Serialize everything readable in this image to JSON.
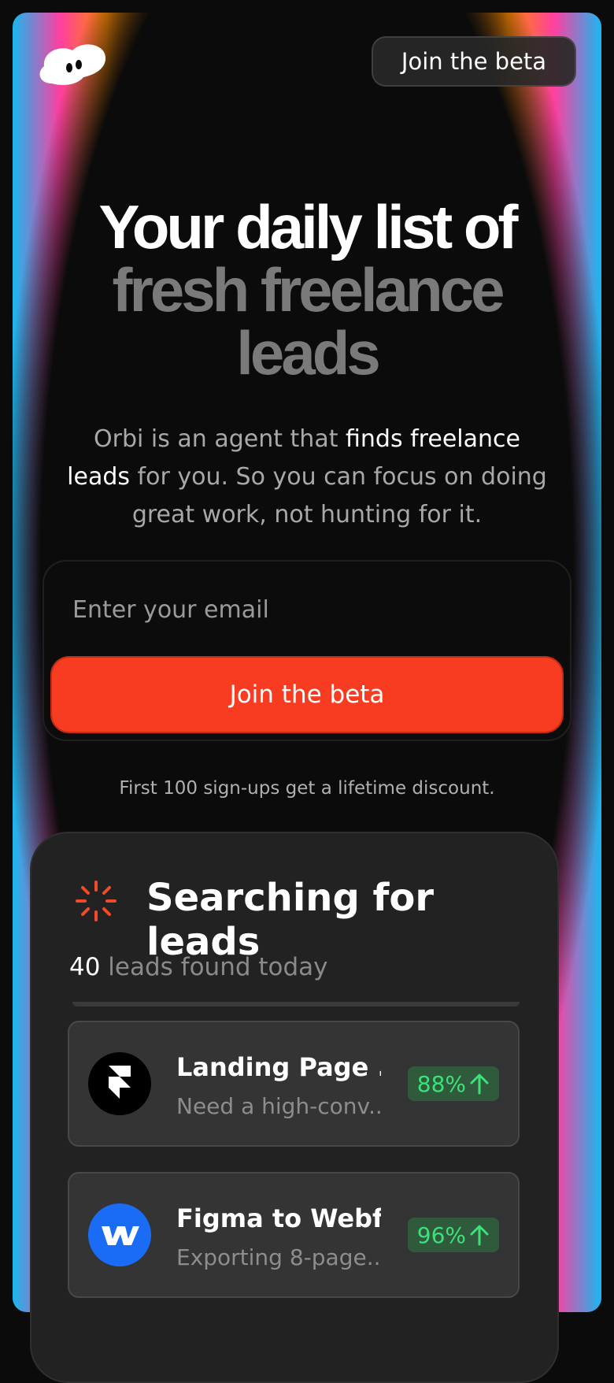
{
  "header": {
    "cta_label": "Join the beta"
  },
  "hero": {
    "line1": "Your daily list of",
    "line2": "fresh freelance",
    "line3": "leads"
  },
  "subtitle": {
    "part1": "Orbi is an agent that ",
    "highlight": "finds freelance leads",
    "part2": " for you. So you can focus on doing great work, not hunting for it."
  },
  "form": {
    "email_placeholder": "Enter your email",
    "submit_label": "Join the beta"
  },
  "note": "First 100 sign-ups get a lifetime discount.",
  "panel": {
    "title": "Searching for leads",
    "count": "40",
    "count_suffix": " leads found today",
    "leads": [
      {
        "title": "Landing Page ...",
        "desc": "Need a high-conv...",
        "score": "88%",
        "icon": "framer-icon"
      },
      {
        "title": "Figma to Webfl...",
        "desc": "Exporting 8-page...",
        "score": "96%",
        "icon": "webflow-icon"
      }
    ]
  },
  "colors": {
    "accent": "#f73c22",
    "score_text": "#3ee07a",
    "score_bg": "#2f5a3c",
    "webflow_blue": "#1a6cf5"
  }
}
